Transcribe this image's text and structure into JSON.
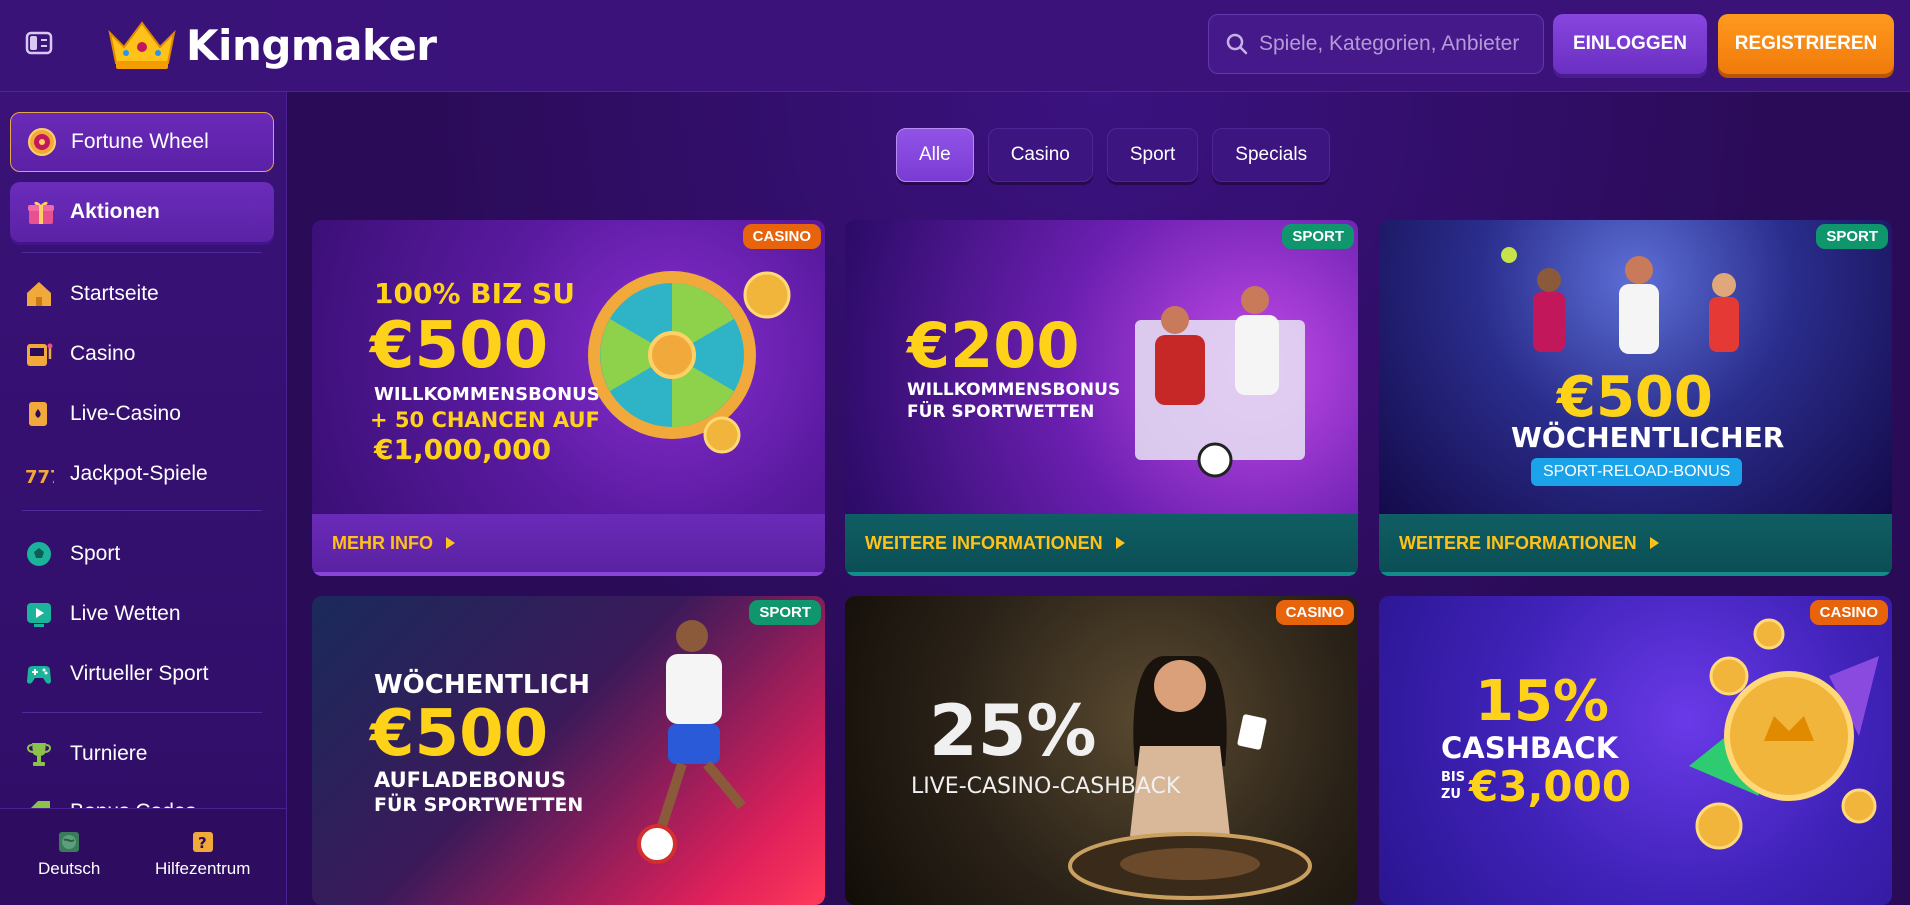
{
  "header": {
    "brand": "Kingmaker",
    "search_placeholder": "Spiele, Kategorien, Anbieter",
    "login_label": "EINLOGGEN",
    "register_label": "REGISTRIEREN"
  },
  "sidebar": {
    "promos": [
      {
        "label": "Fortune Wheel",
        "icon": "fortune-wheel-icon"
      },
      {
        "label": "Aktionen",
        "icon": "gift-icon"
      }
    ],
    "nav": [
      {
        "label": "Startseite",
        "icon": "home-icon"
      },
      {
        "label": "Casino",
        "icon": "slot-machine-icon"
      },
      {
        "label": "Live-Casino",
        "icon": "cards-icon"
      },
      {
        "label": "Jackpot-Spiele",
        "icon": "jackpot-777-icon"
      },
      {
        "label": "Sport",
        "icon": "soccer-ball-icon"
      },
      {
        "label": "Live Wetten",
        "icon": "live-play-icon"
      },
      {
        "label": "Virtueller Sport",
        "icon": "gamepad-icon"
      },
      {
        "label": "Turniere",
        "icon": "trophy-icon"
      },
      {
        "label": "Bonus Codes",
        "icon": "tag-icon"
      }
    ],
    "footer": [
      {
        "label": "Deutsch",
        "icon": "globe-icon"
      },
      {
        "label": "Hilfezentrum",
        "icon": "help-icon"
      }
    ]
  },
  "tabs": [
    "Alle",
    "Casino",
    "Sport",
    "Specials"
  ],
  "cards": [
    {
      "badge": "CASINO",
      "cta": "MEHR INFO",
      "lines": [
        "100% BIZ SU",
        "€500",
        "WILLKOMMENSBONUS",
        "+ 50 CHANCEN AUF",
        "€1,000,000"
      ]
    },
    {
      "badge": "SPORT",
      "cta": "WEITERE INFORMATIONEN",
      "lines": [
        "€200",
        "WILLKOMMENSBONUS",
        "FÜR SPORTWETTEN"
      ]
    },
    {
      "badge": "SPORT",
      "cta": "WEITERE INFORMATIONEN",
      "lines": [
        "€500",
        "WÖCHENTLICHER",
        "SPORT-RELOAD-BONUS"
      ]
    },
    {
      "badge": "SPORT",
      "cta": "",
      "lines": [
        "WÖCHENTLICH",
        "€500",
        "AUFLADEBONUS",
        "FÜR SPORTWETTEN"
      ]
    },
    {
      "badge": "CASINO",
      "cta": "",
      "lines": [
        "25%",
        "LIVE-CASINO-CASHBACK"
      ]
    },
    {
      "badge": "CASINO",
      "cta": "",
      "lines": [
        "15%",
        "CASHBACK",
        "BIS",
        "ZU",
        "€3,000"
      ]
    }
  ],
  "colors": {
    "background": "#2a0b57",
    "header": "#3a1379",
    "accent_orange": "#f07a0a",
    "accent_purple": "#7a3bd4",
    "yellow": "#ffd21a",
    "badge_casino": "#e8640c",
    "badge_sport": "#10966d"
  }
}
